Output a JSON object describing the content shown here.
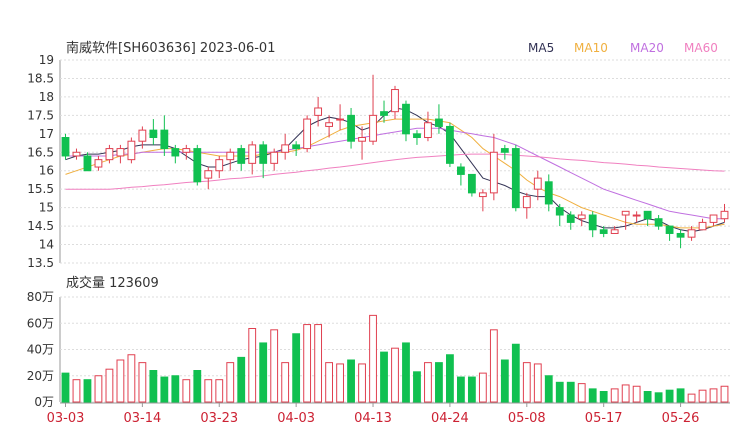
{
  "chart_data": {
    "type": "candlestick",
    "title": "南威软件[SH603636] 2023-06-01",
    "price_ticks": [
      "19",
      "18.5",
      "18",
      "17.5",
      "17",
      "16.5",
      "16",
      "15.5",
      "15",
      "14.5",
      "14",
      "13.5"
    ],
    "price_range": [
      13.5,
      19
    ],
    "volume_title": "成交量 123609",
    "volume_ticks": [
      "80万",
      "60万",
      "40万",
      "20万",
      "0万"
    ],
    "volume_range": [
      0,
      80
    ],
    "x_tick_labels": [
      "03-03",
      "03-14",
      "03-23",
      "04-03",
      "04-13",
      "04-24",
      "05-08",
      "05-17",
      "05-26"
    ],
    "x_tick_index": [
      0,
      7,
      14,
      21,
      28,
      35,
      42,
      49,
      56
    ],
    "legend": [
      {
        "name": "MA5",
        "color": "#333355"
      },
      {
        "name": "MA10",
        "color": "#f0b040"
      },
      {
        "name": "MA20",
        "color": "#c070e0"
      },
      {
        "name": "MA60",
        "color": "#f080c0"
      }
    ],
    "colors": {
      "up": "#e04050",
      "down": "#10c050",
      "grid": "#dddddd"
    },
    "candles": [
      [
        16.9,
        16.4,
        17.0,
        16.3,
        22
      ],
      [
        16.4,
        16.5,
        16.6,
        16.3,
        17
      ],
      [
        16.4,
        16.0,
        16.5,
        16.0,
        17
      ],
      [
        16.1,
        16.3,
        16.4,
        16.0,
        20
      ],
      [
        16.3,
        16.6,
        16.7,
        16.2,
        25
      ],
      [
        16.4,
        16.6,
        16.7,
        16.2,
        32
      ],
      [
        16.3,
        16.8,
        16.9,
        16.2,
        36
      ],
      [
        16.8,
        17.1,
        17.2,
        16.6,
        30
      ],
      [
        17.1,
        16.9,
        17.4,
        16.7,
        24
      ],
      [
        17.1,
        16.6,
        17.5,
        16.4,
        19
      ],
      [
        16.6,
        16.4,
        16.7,
        16.2,
        20
      ],
      [
        16.5,
        16.6,
        16.7,
        16.3,
        17
      ],
      [
        16.6,
        15.7,
        16.7,
        15.6,
        24
      ],
      [
        15.8,
        16.0,
        16.1,
        15.5,
        17
      ],
      [
        16.0,
        16.3,
        16.4,
        15.8,
        17
      ],
      [
        16.3,
        16.5,
        16.6,
        16.0,
        30
      ],
      [
        16.6,
        16.2,
        16.7,
        16.0,
        34
      ],
      [
        16.2,
        16.7,
        16.8,
        15.9,
        56
      ],
      [
        16.7,
        16.2,
        16.8,
        15.8,
        45
      ],
      [
        16.2,
        16.5,
        16.6,
        16.0,
        55
      ],
      [
        16.5,
        16.7,
        17.0,
        16.3,
        30
      ],
      [
        16.7,
        16.6,
        16.8,
        16.4,
        52
      ],
      [
        16.6,
        17.4,
        17.5,
        16.5,
        59
      ],
      [
        17.5,
        17.7,
        18.0,
        17.2,
        59
      ],
      [
        17.2,
        17.3,
        17.5,
        16.9,
        30
      ],
      [
        17.4,
        17.4,
        17.8,
        17.1,
        29
      ],
      [
        17.5,
        16.8,
        17.7,
        16.6,
        32
      ],
      [
        16.8,
        16.9,
        17.2,
        16.3,
        29
      ],
      [
        16.8,
        17.5,
        18.6,
        16.7,
        66
      ],
      [
        17.6,
        17.5,
        17.9,
        17.3,
        38
      ],
      [
        17.6,
        18.2,
        18.3,
        17.4,
        41
      ],
      [
        17.8,
        17.0,
        17.9,
        16.8,
        45
      ],
      [
        17.0,
        16.9,
        17.1,
        16.7,
        23
      ],
      [
        16.9,
        17.3,
        17.6,
        16.8,
        30
      ],
      [
        17.4,
        17.2,
        17.8,
        17.0,
        30
      ],
      [
        17.2,
        16.2,
        17.3,
        16.1,
        36
      ],
      [
        16.1,
        15.9,
        16.2,
        15.6,
        19
      ],
      [
        15.9,
        15.4,
        15.9,
        15.3,
        19
      ],
      [
        15.3,
        15.4,
        15.5,
        14.9,
        22
      ],
      [
        15.4,
        16.5,
        17.0,
        15.2,
        55
      ],
      [
        16.6,
        16.5,
        16.7,
        16.3,
        32
      ],
      [
        16.6,
        15.0,
        16.7,
        14.9,
        44
      ],
      [
        15.0,
        15.3,
        15.4,
        14.7,
        30
      ],
      [
        15.5,
        15.8,
        16.0,
        15.2,
        29
      ],
      [
        15.7,
        15.1,
        15.9,
        14.9,
        20
      ],
      [
        15.0,
        14.8,
        15.1,
        14.5,
        15
      ],
      [
        14.8,
        14.6,
        14.9,
        14.4,
        15
      ],
      [
        14.7,
        14.8,
        14.9,
        14.5,
        14
      ],
      [
        14.8,
        14.4,
        14.9,
        14.2,
        10
      ],
      [
        14.4,
        14.3,
        14.5,
        14.2,
        8
      ],
      [
        14.3,
        14.4,
        14.5,
        14.3,
        10
      ],
      [
        14.8,
        14.9,
        14.9,
        14.4,
        13
      ],
      [
        14.8,
        14.8,
        14.9,
        14.6,
        12
      ],
      [
        14.9,
        14.7,
        14.9,
        14.5,
        8
      ],
      [
        14.7,
        14.5,
        14.8,
        14.4,
        7
      ],
      [
        14.5,
        14.3,
        14.5,
        14.1,
        9
      ],
      [
        14.3,
        14.2,
        14.4,
        13.9,
        10
      ],
      [
        14.2,
        14.4,
        14.5,
        14.1,
        6
      ],
      [
        14.4,
        14.6,
        14.7,
        14.4,
        9
      ],
      [
        14.6,
        14.8,
        14.8,
        14.5,
        10
      ],
      [
        14.7,
        14.9,
        15.1,
        14.6,
        12
      ]
    ],
    "ma5": [
      16.3,
      16.4,
      16.45,
      16.45,
      16.5,
      16.55,
      16.65,
      16.7,
      16.7,
      16.7,
      16.6,
      16.4,
      16.2,
      16.1,
      16.1,
      16.2,
      16.3,
      16.35,
      16.4,
      16.5,
      16.6,
      16.9,
      17.2,
      17.35,
      17.45,
      17.4,
      17.3,
      17.1,
      17.2,
      17.5,
      17.7,
      17.65,
      17.5,
      17.3,
      17.2,
      17.0,
      16.6,
      16.2,
      15.8,
      15.7,
      15.6,
      15.45,
      15.35,
      15.3,
      15.3,
      15.0,
      14.8,
      14.65,
      14.55,
      14.45,
      14.45,
      14.5,
      14.6,
      14.7,
      14.65,
      14.5,
      14.4,
      14.35,
      14.4,
      14.5,
      14.6
    ],
    "ma10": [
      15.9,
      16.0,
      16.1,
      16.2,
      16.3,
      16.4,
      16.45,
      16.5,
      16.55,
      16.6,
      16.6,
      16.55,
      16.5,
      16.45,
      16.4,
      16.4,
      16.4,
      16.4,
      16.45,
      16.5,
      16.5,
      16.55,
      16.65,
      16.8,
      16.95,
      17.1,
      17.2,
      17.25,
      17.3,
      17.35,
      17.4,
      17.4,
      17.4,
      17.4,
      17.35,
      17.3,
      17.1,
      16.9,
      16.6,
      16.4,
      16.2,
      16.0,
      15.75,
      15.55,
      15.4,
      15.3,
      15.15,
      15.0,
      14.9,
      14.8,
      14.7,
      14.6,
      14.55,
      14.55,
      14.55,
      14.5,
      14.45,
      14.45,
      14.45,
      14.5,
      14.55
    ],
    "ma20": [
      16.4,
      16.4,
      16.4,
      16.4,
      16.4,
      16.45,
      16.45,
      16.5,
      16.5,
      16.5,
      16.5,
      16.5,
      16.5,
      16.5,
      16.5,
      16.5,
      16.5,
      16.5,
      16.5,
      16.5,
      16.55,
      16.6,
      16.65,
      16.7,
      16.75,
      16.8,
      16.85,
      16.9,
      16.95,
      17.0,
      17.05,
      17.1,
      17.15,
      17.15,
      17.15,
      17.1,
      17.05,
      17.0,
      16.95,
      16.9,
      16.8,
      16.7,
      16.55,
      16.4,
      16.25,
      16.1,
      15.95,
      15.8,
      15.65,
      15.5,
      15.4,
      15.3,
      15.2,
      15.1,
      15.0,
      14.9,
      14.85,
      14.8,
      14.75,
      14.7,
      14.7
    ],
    "ma60": [
      15.5,
      15.5,
      15.5,
      15.5,
      15.5,
      15.52,
      15.55,
      15.57,
      15.6,
      15.62,
      15.65,
      15.68,
      15.7,
      15.72,
      15.75,
      15.78,
      15.8,
      15.83,
      15.86,
      15.9,
      15.93,
      15.96,
      16.0,
      16.03,
      16.07,
      16.1,
      16.14,
      16.18,
      16.22,
      16.26,
      16.3,
      16.33,
      16.36,
      16.38,
      16.4,
      16.42,
      16.44,
      16.45,
      16.45,
      16.45,
      16.44,
      16.42,
      16.4,
      16.38,
      16.35,
      16.32,
      16.3,
      16.28,
      16.25,
      16.22,
      16.2,
      16.18,
      16.15,
      16.13,
      16.1,
      16.08,
      16.06,
      16.04,
      16.02,
      16.0,
      15.99
    ]
  }
}
